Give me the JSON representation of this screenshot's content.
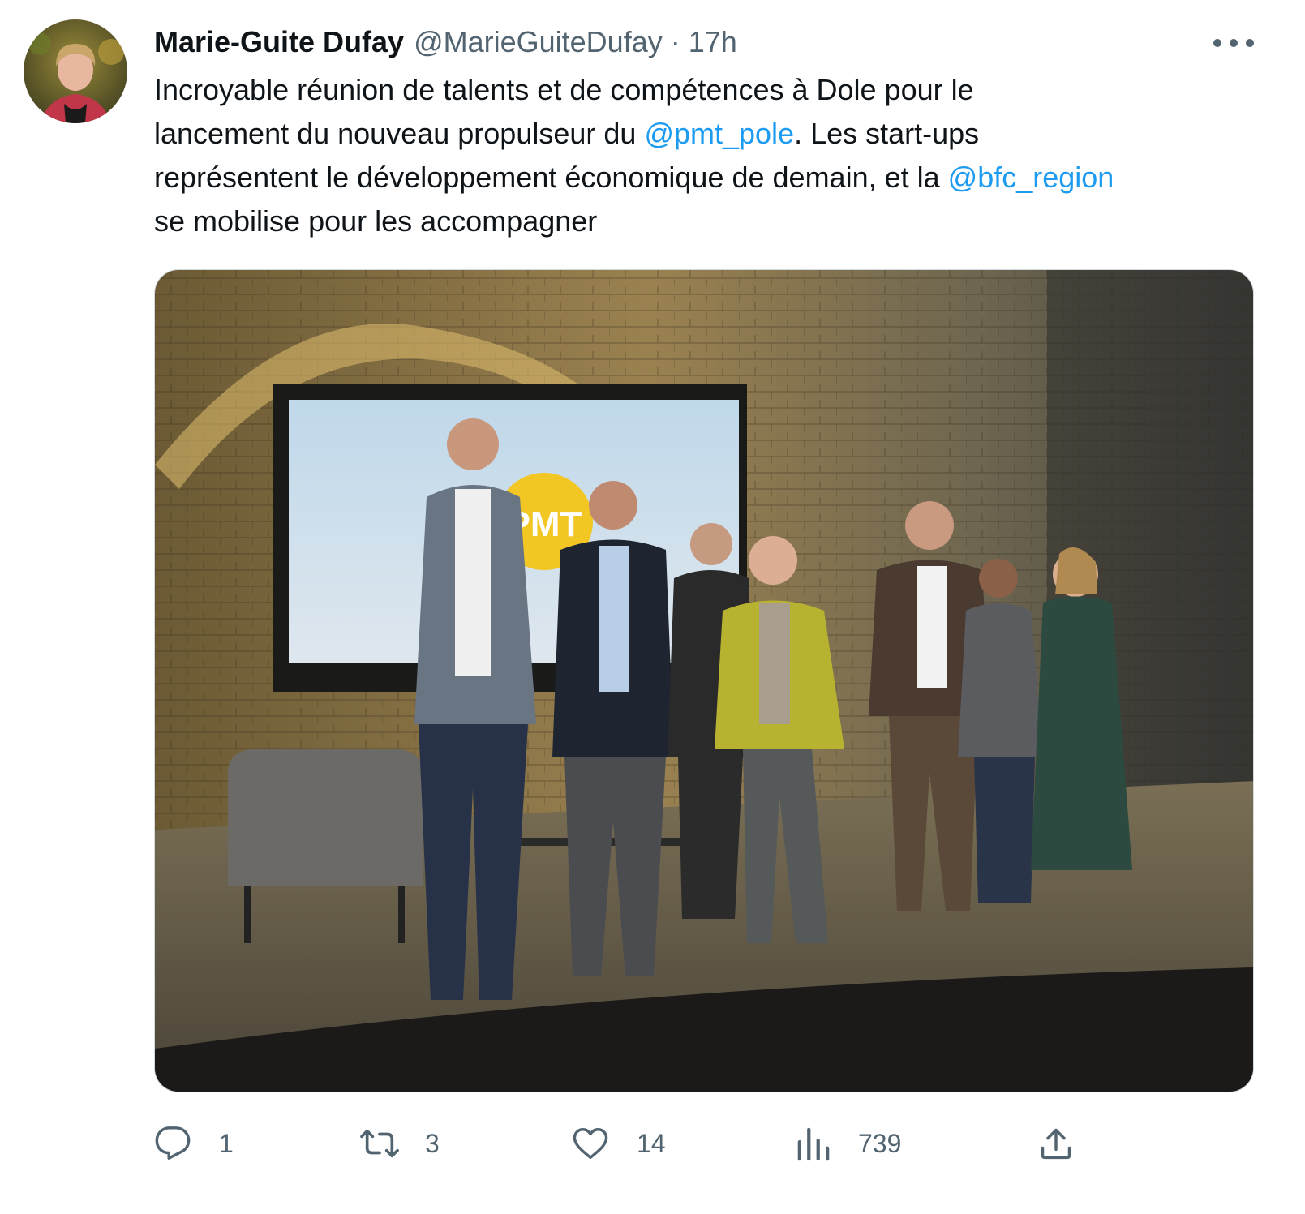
{
  "tweet": {
    "author_name": "Marie-Guite Dufay",
    "handle": "@MarieGuiteDufay",
    "separator": "·",
    "time": "17h",
    "text": {
      "line1": "Incroyable réunion de talents et de compétences à Dole pour le",
      "line2_before": "lancement du nouveau propulseur du ",
      "mention1": "@pmt_pole",
      "line2_after": ". Les start-ups",
      "line3_before": "représentent le développement économique de demain, et la ",
      "mention2": "@bfc_region",
      "line4": "se mobilise pour les accompagner"
    },
    "media": {
      "screen_logo_text": "PMT"
    }
  },
  "actions": {
    "reply": {
      "icon": "reply-icon",
      "count": "1"
    },
    "retweet": {
      "icon": "retweet-icon",
      "count": "3"
    },
    "like": {
      "icon": "heart-icon",
      "count": "14"
    },
    "views": {
      "icon": "views-icon",
      "count": "739"
    },
    "share": {
      "icon": "share-icon"
    }
  },
  "colors": {
    "text": "#0f1419",
    "secondary": "#536471",
    "link": "#1d9bf0"
  }
}
